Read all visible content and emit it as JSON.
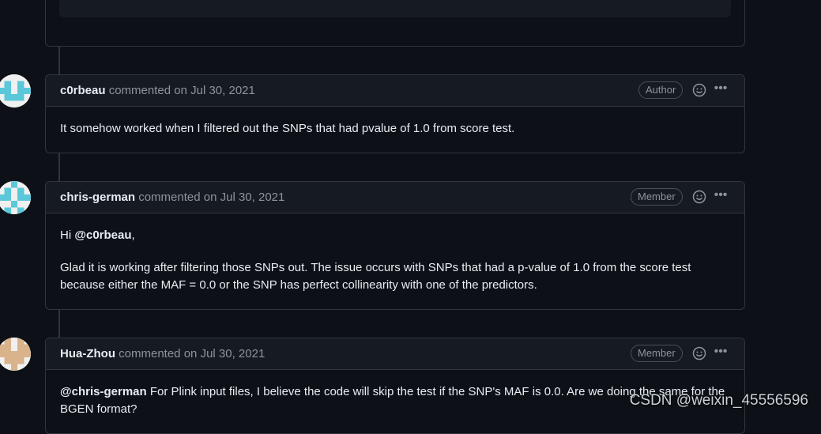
{
  "previous": {
    "code_fragment": "}"
  },
  "comments": [
    {
      "author": "c0rbeau",
      "action": "commented on",
      "date": "Jul 30, 2021",
      "role": "Author",
      "body": [
        "It somehow worked when I filtered out the SNPs that had pvalue of 1.0 from score test."
      ]
    },
    {
      "author": "chris-german",
      "action": "commented on",
      "date": "Jul 30, 2021",
      "role": "Member",
      "greeting": "Hi ",
      "mention": "@c0rbeau",
      "greeting_end": ",",
      "body": [
        "Glad it is working after filtering those SNPs out. The issue occurs with SNPs that had a p-value of 1.0 from the score test because either the MAF = 0.0 or the SNP has perfect collinearity with one of the predictors."
      ]
    },
    {
      "author": "Hua-Zhou",
      "action": "commented on",
      "date": "Jul 30, 2021",
      "role": "Member",
      "mention": "@chris-german",
      "body": [
        " For Plink input files, I believe the code will skip the test if the SNP's MAF is 0.0. Are we doing the same for the BGEN format?"
      ]
    }
  ],
  "watermark": "CSDN @weixin_45556596"
}
